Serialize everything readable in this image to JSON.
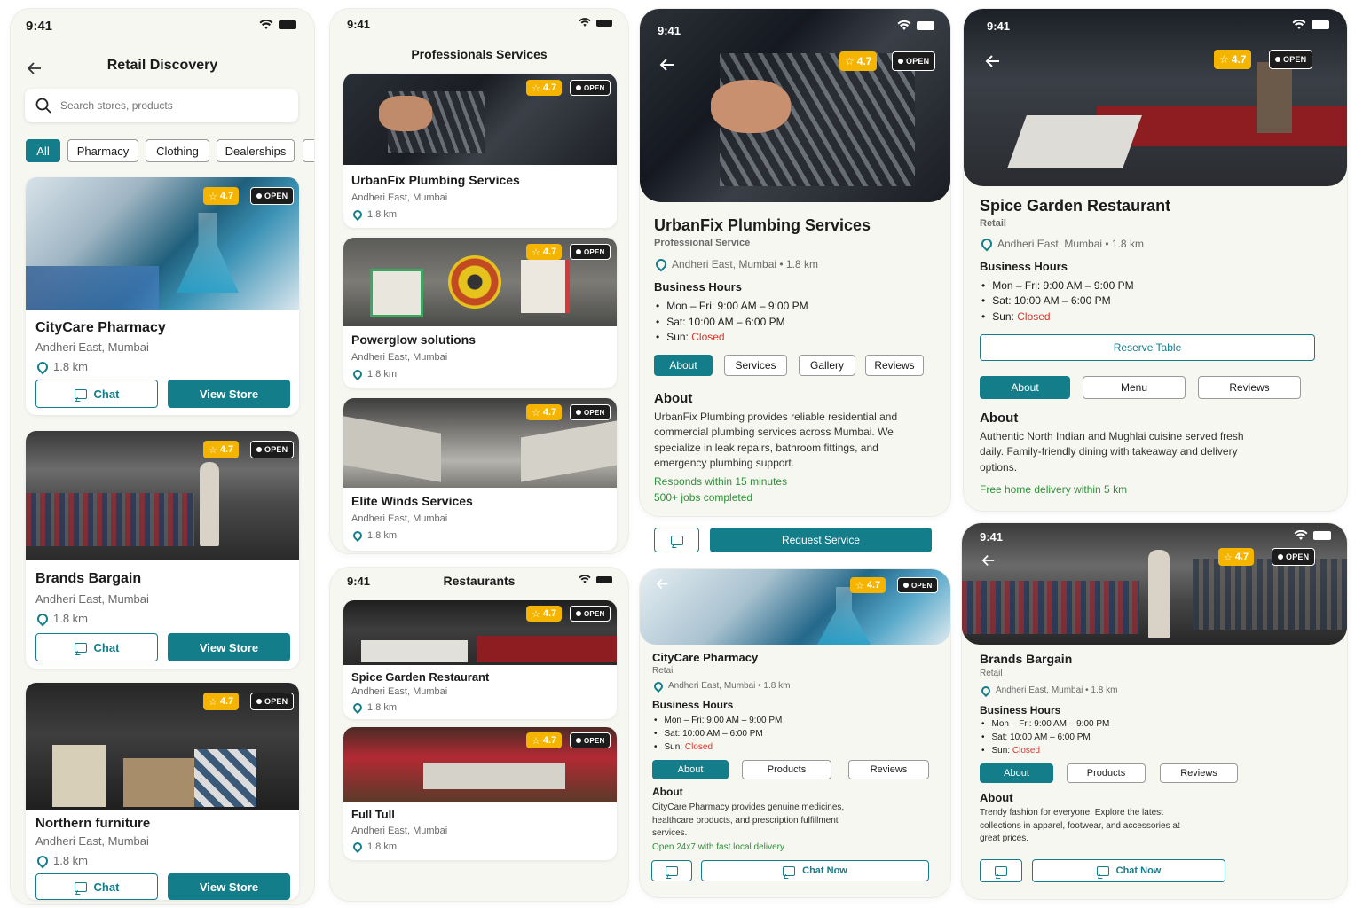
{
  "colors": {
    "teal": "#137d8a",
    "rating": "#f5b400",
    "closed": "#d8372a",
    "green_note": "#2f8f3a"
  },
  "status": {
    "time": "9:41"
  },
  "rating": "4.7",
  "open": "OPEN",
  "distance": "1.8 km",
  "area": "Andheri East, Mumbai",
  "discovery": {
    "title": "Retail Discovery",
    "search_placeholder": "Search stores, products",
    "filters": [
      "All",
      "Pharmacy",
      "Clothing",
      "Dealerships"
    ],
    "stores": [
      {
        "name": "CityCare Pharmacy"
      },
      {
        "name": "Brands Bargain"
      },
      {
        "name": "Northern furniture"
      }
    ],
    "chat": "Chat",
    "view": "View Store"
  },
  "professionals": {
    "title": "Professionals Services",
    "items": [
      {
        "name": "UrbanFix Plumbing Services"
      },
      {
        "name": "Powerglow solutions"
      },
      {
        "name": "Elite Winds Services"
      }
    ]
  },
  "restaurants": {
    "title": "Restaurants",
    "items": [
      {
        "name": "Spice Garden Restaurant"
      },
      {
        "name": "Full Tull"
      }
    ]
  },
  "hours": {
    "label": "Business Hours",
    "weekday": "Mon – Fri: 9:00 AM – 9:00 PM",
    "sat": "Sat: 10:00 AM – 6:00 PM",
    "sun": "Sun: ",
    "closed": "Closed"
  },
  "plumbing": {
    "name": "UrbanFix Plumbing Services",
    "category": "Professional Service",
    "loc": "Andheri East, Mumbai • 1.8 km",
    "tabs": [
      "About",
      "Services",
      "Gallery",
      "Reviews"
    ],
    "about_h": "About",
    "about": "UrbanFix Plumbing provides reliable residential and commercial plumbing services across Mumbai. We specialize in leak repairs, bathroom fittings, and emergency plumbing support.",
    "note1": "Responds within 15 minutes",
    "note2": "500+ jobs completed",
    "cta": "Request Service"
  },
  "spice": {
    "name": "Spice Garden Restaurant",
    "category": "Retail",
    "loc": "Andheri East, Mumbai • 1.8 km",
    "reserve": "Reserve Table",
    "tabs": [
      "About",
      "Menu",
      "Reviews"
    ],
    "about_h": "About",
    "about": "Authentic North Indian and Mughlai cuisine served fresh daily. Family-friendly dining with takeaway and delivery options.",
    "note": "Free home delivery within 5 km"
  },
  "citycare": {
    "name": "CityCare Pharmacy",
    "category": "Retail",
    "loc": "Andheri East, Mumbai • 1.8 km",
    "tabs": [
      "About",
      "Products",
      "Reviews"
    ],
    "about_h": "About",
    "about": "CityCare Pharmacy provides genuine medicines, healthcare products, and prescription fulfillment services.",
    "note": "Open 24x7 with fast local delivery.",
    "cta": "Chat Now"
  },
  "brands": {
    "name": "Brands Bargain",
    "category": "Retail",
    "loc": "Andheri East, Mumbai • 1.8 km",
    "tabs": [
      "About",
      "Products",
      "Reviews"
    ],
    "about_h": "About",
    "about": "Trendy fashion for everyone. Explore the latest collections in apparel, footwear, and accessories at great prices.",
    "cta": "Chat Now"
  }
}
